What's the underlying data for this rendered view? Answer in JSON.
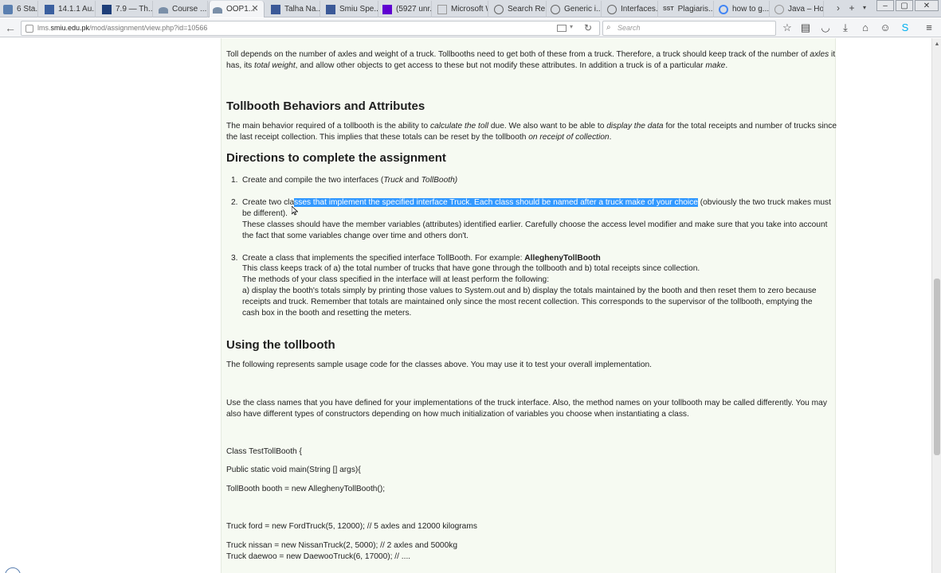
{
  "tabs": [
    {
      "label": "6 Sta...",
      "icon": "calendar-icon",
      "color": "#5a7fb0"
    },
    {
      "label": "14.1.1 Au...",
      "icon": "book-icon",
      "color": "#3a5f9f"
    },
    {
      "label": "7.9 — Th...",
      "icon": "page-icon",
      "color": "#1f3f7a"
    },
    {
      "label": "Course ...",
      "icon": "moodle-icon",
      "color": "#7a8fa8"
    },
    {
      "label": "OOP1...",
      "icon": "moodle-icon",
      "color": "#7a8fa8"
    },
    {
      "label": "Talha Na...",
      "icon": "facebook-icon",
      "color": "#3b5998"
    },
    {
      "label": "Smiu Spe...",
      "icon": "facebook-icon",
      "color": "#3b5998"
    },
    {
      "label": "(5927 unr...",
      "icon": "yahoo-icon",
      "color": "#5f01d1"
    },
    {
      "label": "Microsoft Wo...",
      "icon": "page-icon",
      "color": "#999999"
    },
    {
      "label": "Search Re...",
      "icon": "search-results-icon",
      "color": "#666666"
    },
    {
      "label": "Generic i...",
      "icon": "search-results-icon",
      "color": "#666666"
    },
    {
      "label": "Interfaces...",
      "icon": "search-results-icon",
      "color": "#666666"
    },
    {
      "label": "Plagiaris...",
      "icon": "sst-icon",
      "color": "#444444",
      "badge": "SST"
    },
    {
      "label": "how to g...",
      "icon": "google-icon",
      "color": "#4285f4"
    },
    {
      "label": "Java – Ho...",
      "icon": "java-icon",
      "color": "#999999"
    }
  ],
  "url": {
    "prefix": "lms.",
    "domain": "smiu.edu.pk",
    "path": "/mod/assignment/view.php?id=10566"
  },
  "search": {
    "placeholder": "Search"
  },
  "content": {
    "intro_line1_parts": [
      "Toll depends on the number of axles and weight of a truck.  Tollbooths need to get both of these from a truck. Therefore, a truck should keep track of the number of ",
      "axles",
      " it"
    ],
    "intro_line2_parts": [
      "has, its ",
      "total weight",
      ", and allow other objects to get access to these but not modify these attributes.  In addition a truck is of a particular ",
      "make",
      "."
    ],
    "h_behaviors": "Tollbooth Behaviors and Attributes",
    "beh_line1_parts": [
      "The main behavior required of a tollbooth is the ability to ",
      "calculate the toll",
      " due.  We also want to be able to ",
      "display the data",
      " for the total receipts and number of trucks since"
    ],
    "beh_line2_parts": [
      "the last receipt collection.  This implies that these totals can be reset by the tollbooth ",
      "on receipt of collection",
      "."
    ],
    "h_directions": "Directions to complete the assignment",
    "item1_parts": [
      "Create and compile the two interfaces (",
      "Truck",
      " and ",
      "TollBooth)"
    ],
    "item2_l1_pre": "Create two cla",
    "item2_l1_hl": "sses that implement the specified interface Truck. Each class should be named after a truck make of your choice",
    "item2_l1_post": " (obviously the two truck makes must",
    "item2_l2": "be different).",
    "item2_l3": "These classes should have the member variables (attributes) identified earlier. Carefully choose the access level modifier and make sure that you take into account",
    "item2_l4": "the fact that some variables change over time and others don't.",
    "item3_l1_pre": "Create a class that implements the specified interface TollBooth.  For example: ",
    "item3_l1_bold": "AlleghenyTollBooth",
    "item3_l2": "This class keeps track of a) the total number of trucks that have gone through the tollbooth and b) total receipts since collection.",
    "item3_l3": "The methods of your class specified in the interface will at least perform the following:",
    "item3_l4": "a) display the booth's totals simply by printing those values to System.out and b) display the totals maintained by the booth and then reset them to zero because",
    "item3_l5": "receipts and truck. Remember that totals are maintained only since the most recent collection.  This corresponds to the supervisor of the tollbooth, emptying the",
    "item3_l6": "cash box in the booth and resetting the meters.",
    "h_using": "Using the tollbooth",
    "using_l1": "The following represents sample usage code for the classes above.  You may use it to test your overall implementation.",
    "using_l2": "Use the class names that you have defined for your implementations of the truck interface. Also, the method names on your tollbooth may be called differently. You may",
    "using_l3": "also have different types of constructors depending on how much initialization of variables you choose when instantiating a class.",
    "code": [
      "Class TestTollBooth {",
      "Public static void main(String [] args){",
      "TollBooth booth = new AlleghenyTollBooth();",
      "Truck ford = new FordTruck(5, 12000); // 5 axles and 12000 kilograms",
      "Truck nissan = new NissanTruck(2, 5000); // 2 axles and 5000kg",
      "Truck daewoo = new DaewooTruck(6, 17000); // ...."
    ]
  },
  "colors": {
    "highlight": "#3399ff",
    "content_bg": "#f6faf2",
    "tab_strip": "#d9dde3"
  }
}
